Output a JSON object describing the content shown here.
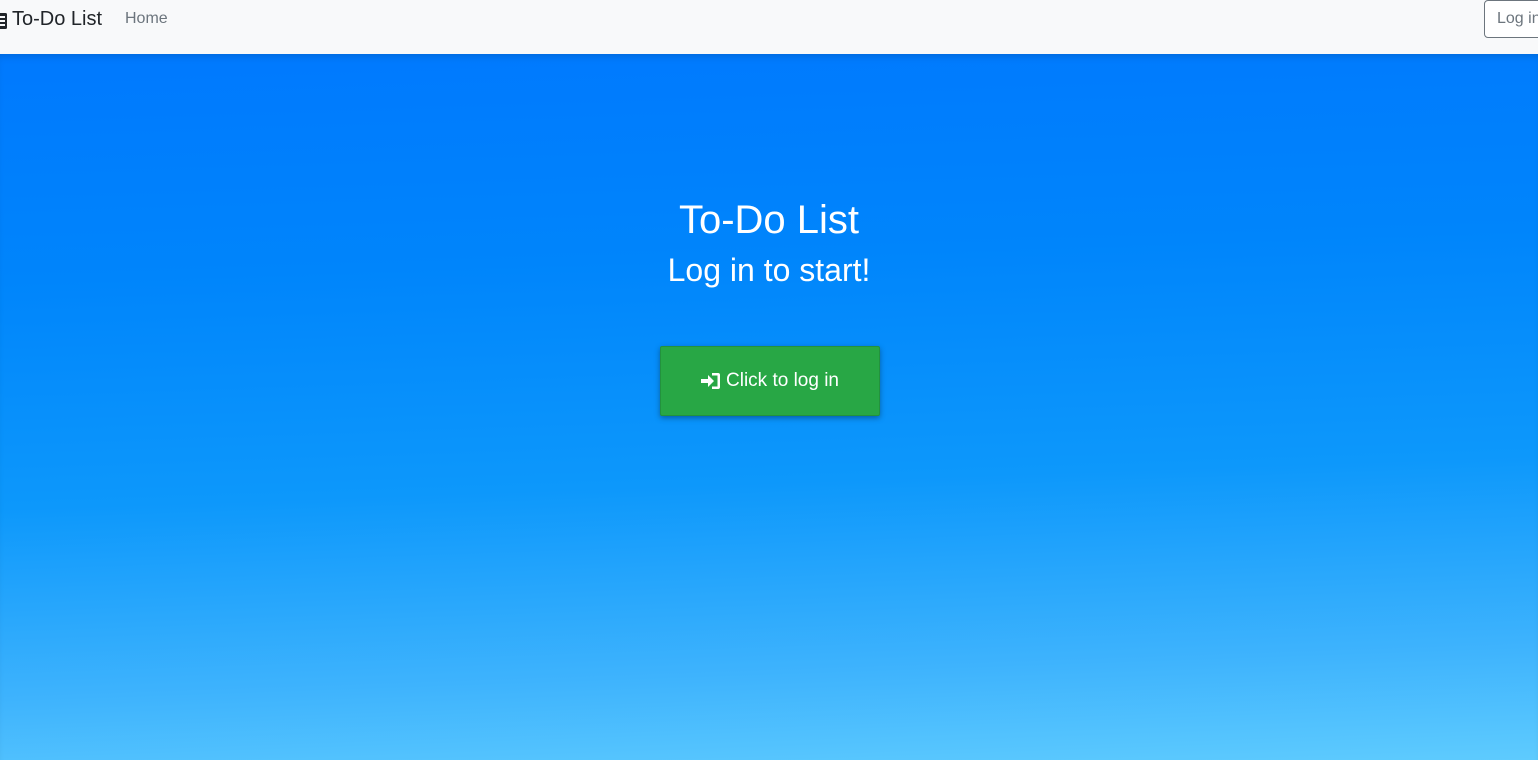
{
  "navbar": {
    "brand_label": "To-Do List",
    "brand_icon": "list-icon",
    "home_label": "Home",
    "login_label": "Log in",
    "background": "#f8f9fa"
  },
  "hero": {
    "title": "To-Do List",
    "subtitle": "Log in to start!",
    "cta_label": "Click to log in",
    "cta_icon": "sign-in-icon",
    "cta_color": "#28a745",
    "background_top": "#0079fe",
    "background_bottom": "#5ecbfe"
  }
}
